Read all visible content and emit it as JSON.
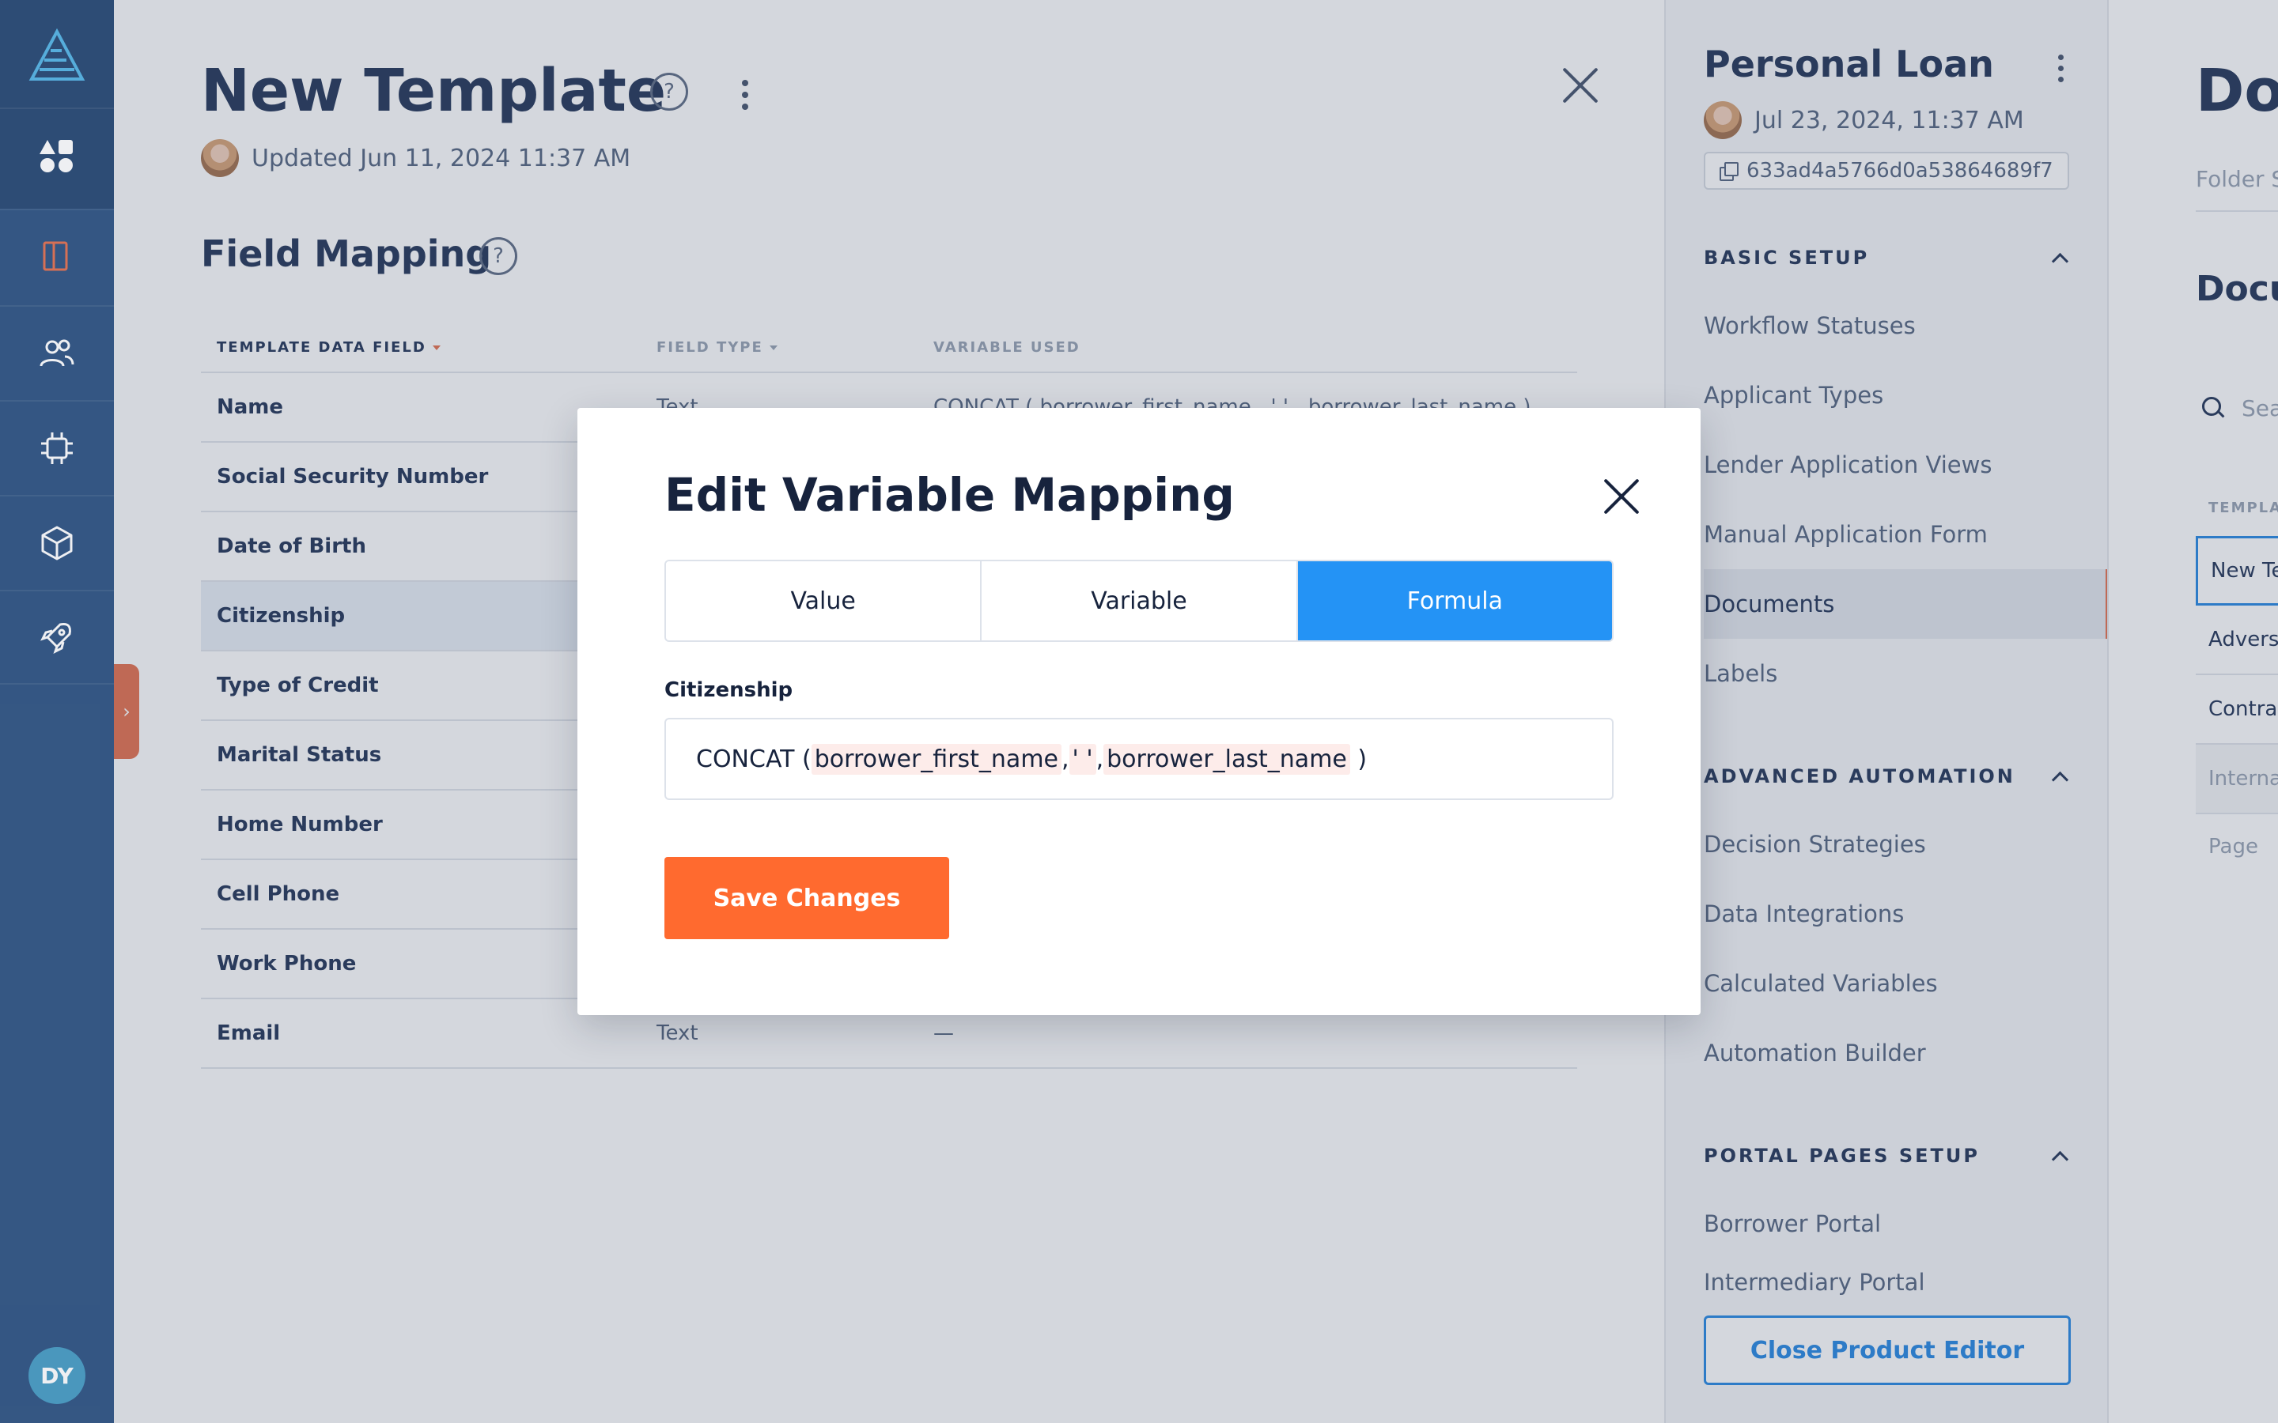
{
  "rail": {
    "avatar_initials": "DY",
    "items": [
      "apps-icon",
      "template-icon",
      "users-icon",
      "chip-icon",
      "box-icon",
      "rocket-icon"
    ]
  },
  "page": {
    "title": "New Template",
    "updated": "Updated Jun 11, 2024 11:37 AM",
    "help": "?",
    "section_title": "Field Mapping"
  },
  "table": {
    "headers": [
      "TEMPLATE DATA FIELD",
      "FIELD TYPE",
      "VARIABLE USED"
    ],
    "rows": [
      {
        "field": "Name",
        "type": "Text",
        "variable": "CONCAT ( borrower_first_name , ' ' , borrower_last_name )"
      },
      {
        "field": "Social Security Number",
        "type": "",
        "variable": ""
      },
      {
        "field": "Date of Birth",
        "type": "",
        "variable": ""
      },
      {
        "field": "Citizenship",
        "type": "",
        "variable": ""
      },
      {
        "field": "Type of Credit",
        "type": "",
        "variable": ""
      },
      {
        "field": "Marital Status",
        "type": "",
        "variable": ""
      },
      {
        "field": "Home Number",
        "type": "",
        "variable": ""
      },
      {
        "field": "Cell Phone",
        "type": "",
        "variable": ""
      },
      {
        "field": "Work Phone",
        "type": "",
        "variable": ""
      },
      {
        "field": "Email",
        "type": "Text",
        "variable": "—"
      }
    ]
  },
  "product": {
    "title": "Personal Loan",
    "date": "Jul 23, 2024, 11:37 AM",
    "id": "633ad4a5766d0a53864689f7",
    "groups": [
      {
        "title": "BASIC SETUP",
        "items": [
          "Workflow Statuses",
          "Applicant Types",
          "Lender Application Views",
          "Manual Application Form",
          "Documents",
          "Labels"
        ]
      },
      {
        "title": "ADVANCED AUTOMATION",
        "items": [
          "Decision Strategies",
          "Data Integrations",
          "Calculated Variables",
          "Automation Builder"
        ]
      },
      {
        "title": "PORTAL PAGES SETUP",
        "items": [
          "Borrower Portal",
          "Intermediary Portal"
        ]
      }
    ],
    "close_button": "Close Product Editor"
  },
  "far": {
    "title": "Do",
    "subtitle": "Folder S",
    "section": "Docu",
    "search_placeholder": "Sea",
    "header": "TEMPLA",
    "rows": [
      "New Te",
      "Advers",
      "Contra",
      "Interna"
    ],
    "page": "Page"
  },
  "modal": {
    "title": "Edit Variable Mapping",
    "tabs": [
      "Value",
      "Variable",
      "Formula"
    ],
    "active_tab": "Formula",
    "field_label": "Citizenship",
    "formula": {
      "fn": "CONCAT",
      "open": "(",
      "arg1": "borrower_first_name",
      "sep1": ",",
      "arg2": "' '",
      "sep2": ",",
      "arg3": "borrower_last_name",
      "close": ")"
    },
    "save_label": "Save Changes"
  },
  "colors": {
    "rail": "#365a87",
    "accent_orange": "#ff6a2f",
    "accent_blue": "#2493f5",
    "title": "#2b3d5e"
  }
}
